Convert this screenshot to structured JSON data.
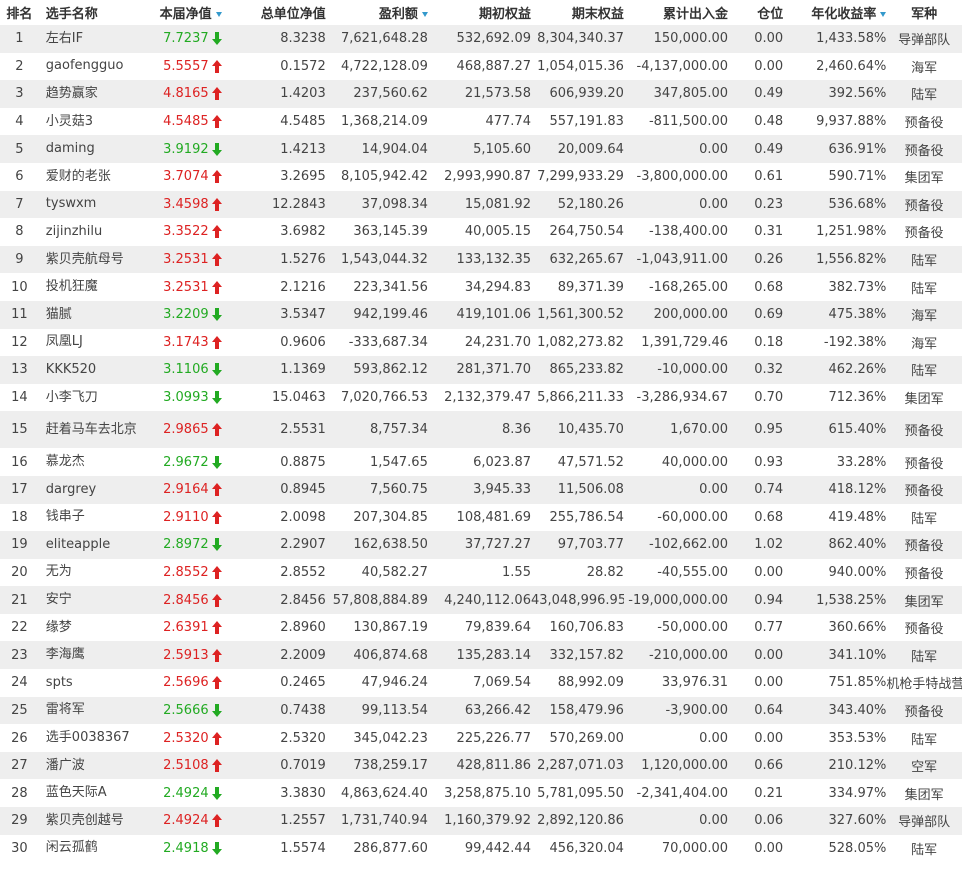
{
  "headers": {
    "rank": "排名",
    "name": "选手名称",
    "nav": "本届净值",
    "total_nav": "总单位净值",
    "profit": "盈利额",
    "initial_equity": "期初权益",
    "final_equity": "期末权益",
    "net_inout": "累计出入金",
    "position": "仓位",
    "annual_return": "年化收益率",
    "army": "军种"
  },
  "sorted_columns": [
    "nav",
    "profit",
    "annual_return"
  ],
  "colors": {
    "up": "#dd2222",
    "down": "#22aa22",
    "sort_icon": "#3399cc",
    "row_even": "#eeeeee"
  },
  "rows": [
    {
      "rank": "1",
      "name": "左右IF",
      "nav": "7.7237",
      "trend": "down",
      "total_nav": "8.3238",
      "profit": "7,621,648.28",
      "initial_equity": "532,692.09",
      "final_equity": "8,304,340.37",
      "net_inout": "150,000.00",
      "position": "0.00",
      "annual_return": "1,433.58%",
      "army": "导弹部队"
    },
    {
      "rank": "2",
      "name": "gaofengguo",
      "nav": "5.5557",
      "trend": "up",
      "total_nav": "0.1572",
      "profit": "4,722,128.09",
      "initial_equity": "468,887.27",
      "final_equity": "1,054,015.36",
      "net_inout": "-4,137,000.00",
      "position": "0.00",
      "annual_return": "2,460.64%",
      "army": "海军"
    },
    {
      "rank": "3",
      "name": "趋势赢家",
      "nav": "4.8165",
      "trend": "up",
      "total_nav": "1.4203",
      "profit": "237,560.62",
      "initial_equity": "21,573.58",
      "final_equity": "606,939.20",
      "net_inout": "347,805.00",
      "position": "0.49",
      "annual_return": "392.56%",
      "army": "陆军"
    },
    {
      "rank": "4",
      "name": "小灵菇3",
      "nav": "4.5485",
      "trend": "up",
      "total_nav": "4.5485",
      "profit": "1,368,214.09",
      "initial_equity": "477.74",
      "final_equity": "557,191.83",
      "net_inout": "-811,500.00",
      "position": "0.48",
      "annual_return": "9,937.88%",
      "army": "预备役"
    },
    {
      "rank": "5",
      "name": "daming",
      "nav": "3.9192",
      "trend": "down",
      "total_nav": "1.4213",
      "profit": "14,904.04",
      "initial_equity": "5,105.60",
      "final_equity": "20,009.64",
      "net_inout": "0.00",
      "position": "0.49",
      "annual_return": "636.91%",
      "army": "预备役"
    },
    {
      "rank": "6",
      "name": "爱财的老张",
      "nav": "3.7074",
      "trend": "up",
      "total_nav": "3.2695",
      "profit": "8,105,942.42",
      "initial_equity": "2,993,990.87",
      "final_equity": "7,299,933.29",
      "net_inout": "-3,800,000.00",
      "position": "0.61",
      "annual_return": "590.71%",
      "army": "集团军"
    },
    {
      "rank": "7",
      "name": "tyswxm",
      "nav": "3.4598",
      "trend": "up",
      "total_nav": "12.2843",
      "profit": "37,098.34",
      "initial_equity": "15,081.92",
      "final_equity": "52,180.26",
      "net_inout": "0.00",
      "position": "0.23",
      "annual_return": "536.68%",
      "army": "预备役"
    },
    {
      "rank": "8",
      "name": "zijinzhilu",
      "nav": "3.3522",
      "trend": "up",
      "total_nav": "3.6982",
      "profit": "363,145.39",
      "initial_equity": "40,005.15",
      "final_equity": "264,750.54",
      "net_inout": "-138,400.00",
      "position": "0.31",
      "annual_return": "1,251.98%",
      "army": "预备役"
    },
    {
      "rank": "9",
      "name": "紫贝壳航母号",
      "nav": "3.2531",
      "trend": "up",
      "total_nav": "1.5276",
      "profit": "1,543,044.32",
      "initial_equity": "133,132.35",
      "final_equity": "632,265.67",
      "net_inout": "-1,043,911.00",
      "position": "0.26",
      "annual_return": "1,556.82%",
      "army": "陆军"
    },
    {
      "rank": "10",
      "name": "投机狂魔",
      "nav": "3.2531",
      "trend": "up",
      "total_nav": "2.1216",
      "profit": "223,341.56",
      "initial_equity": "34,294.83",
      "final_equity": "89,371.39",
      "net_inout": "-168,265.00",
      "position": "0.68",
      "annual_return": "382.73%",
      "army": "陆军"
    },
    {
      "rank": "11",
      "name": "猫腻",
      "nav": "3.2209",
      "trend": "down",
      "total_nav": "3.5347",
      "profit": "942,199.46",
      "initial_equity": "419,101.06",
      "final_equity": "1,561,300.52",
      "net_inout": "200,000.00",
      "position": "0.69",
      "annual_return": "475.38%",
      "army": "海军"
    },
    {
      "rank": "12",
      "name": "凤凰LJ",
      "nav": "3.1743",
      "trend": "up",
      "total_nav": "0.9606",
      "profit": "-333,687.34",
      "initial_equity": "24,231.70",
      "final_equity": "1,082,273.82",
      "net_inout": "1,391,729.46",
      "position": "0.18",
      "annual_return": "-192.38%",
      "army": "海军"
    },
    {
      "rank": "13",
      "name": "KKK520",
      "nav": "3.1106",
      "trend": "down",
      "total_nav": "1.1369",
      "profit": "593,862.12",
      "initial_equity": "281,371.70",
      "final_equity": "865,233.82",
      "net_inout": "-10,000.00",
      "position": "0.32",
      "annual_return": "462.26%",
      "army": "陆军"
    },
    {
      "rank": "14",
      "name": "小李飞刀",
      "nav": "3.0993",
      "trend": "down",
      "total_nav": "15.0463",
      "profit": "7,020,766.53",
      "initial_equity": "2,132,379.47",
      "final_equity": "5,866,211.33",
      "net_inout": "-3,286,934.67",
      "position": "0.70",
      "annual_return": "712.36%",
      "army": "集团军"
    },
    {
      "rank": "15",
      "name": "赶着马车去北京",
      "nav": "2.9865",
      "trend": "up",
      "total_nav": "2.5531",
      "profit": "8,757.34",
      "initial_equity": "8.36",
      "final_equity": "10,435.70",
      "net_inout": "1,670.00",
      "position": "0.95",
      "annual_return": "615.40%",
      "army": "预备役",
      "tall": true
    },
    {
      "rank": "16",
      "name": "慕龙杰",
      "nav": "2.9672",
      "trend": "down",
      "total_nav": "0.8875",
      "profit": "1,547.65",
      "initial_equity": "6,023.87",
      "final_equity": "47,571.52",
      "net_inout": "40,000.00",
      "position": "0.93",
      "annual_return": "33.28%",
      "army": "预备役"
    },
    {
      "rank": "17",
      "name": "dargrey",
      "nav": "2.9164",
      "trend": "up",
      "total_nav": "0.8945",
      "profit": "7,560.75",
      "initial_equity": "3,945.33",
      "final_equity": "11,506.08",
      "net_inout": "0.00",
      "position": "0.74",
      "annual_return": "418.12%",
      "army": "预备役"
    },
    {
      "rank": "18",
      "name": "钱串子",
      "nav": "2.9110",
      "trend": "up",
      "total_nav": "2.0098",
      "profit": "207,304.85",
      "initial_equity": "108,481.69",
      "final_equity": "255,786.54",
      "net_inout": "-60,000.00",
      "position": "0.68",
      "annual_return": "419.48%",
      "army": "陆军"
    },
    {
      "rank": "19",
      "name": "eliteapple",
      "nav": "2.8972",
      "trend": "down",
      "total_nav": "2.2907",
      "profit": "162,638.50",
      "initial_equity": "37,727.27",
      "final_equity": "97,703.77",
      "net_inout": "-102,662.00",
      "position": "1.02",
      "annual_return": "862.40%",
      "army": "预备役"
    },
    {
      "rank": "20",
      "name": "无为",
      "nav": "2.8552",
      "trend": "up",
      "total_nav": "2.8552",
      "profit": "40,582.27",
      "initial_equity": "1.55",
      "final_equity": "28.82",
      "net_inout": "-40,555.00",
      "position": "0.00",
      "annual_return": "940.00%",
      "army": "预备役"
    },
    {
      "rank": "21",
      "name": "安宁",
      "nav": "2.8456",
      "trend": "up",
      "total_nav": "2.8456",
      "profit": "57,808,884.89",
      "initial_equity": "4,240,112.06",
      "final_equity": "43,048,996.95",
      "net_inout": "-19,000,000.00",
      "position": "0.94",
      "annual_return": "1,538.25%",
      "army": "集团军"
    },
    {
      "rank": "22",
      "name": "缘梦",
      "nav": "2.6391",
      "trend": "up",
      "total_nav": "2.8960",
      "profit": "130,867.19",
      "initial_equity": "79,839.64",
      "final_equity": "160,706.83",
      "net_inout": "-50,000.00",
      "position": "0.77",
      "annual_return": "360.66%",
      "army": "预备役"
    },
    {
      "rank": "23",
      "name": "李海鹰",
      "nav": "2.5913",
      "trend": "up",
      "total_nav": "2.2009",
      "profit": "406,874.68",
      "initial_equity": "135,283.14",
      "final_equity": "332,157.82",
      "net_inout": "-210,000.00",
      "position": "0.00",
      "annual_return": "341.10%",
      "army": "陆军"
    },
    {
      "rank": "24",
      "name": "spts",
      "nav": "2.5696",
      "trend": "up",
      "total_nav": "0.2465",
      "profit": "47,946.24",
      "initial_equity": "7,069.54",
      "final_equity": "88,992.09",
      "net_inout": "33,976.31",
      "position": "0.00",
      "annual_return": "751.85%",
      "army": "机枪手特战营"
    },
    {
      "rank": "25",
      "name": "雷将军",
      "nav": "2.5666",
      "trend": "down",
      "total_nav": "0.7438",
      "profit": "99,113.54",
      "initial_equity": "63,266.42",
      "final_equity": "158,479.96",
      "net_inout": "-3,900.00",
      "position": "0.64",
      "annual_return": "343.40%",
      "army": "预备役"
    },
    {
      "rank": "26",
      "name": "选手0038367",
      "nav": "2.5320",
      "trend": "up",
      "total_nav": "2.5320",
      "profit": "345,042.23",
      "initial_equity": "225,226.77",
      "final_equity": "570,269.00",
      "net_inout": "0.00",
      "position": "0.00",
      "annual_return": "353.53%",
      "army": "陆军"
    },
    {
      "rank": "27",
      "name": "潘广波",
      "nav": "2.5108",
      "trend": "up",
      "total_nav": "0.7019",
      "profit": "738,259.17",
      "initial_equity": "428,811.86",
      "final_equity": "2,287,071.03",
      "net_inout": "1,120,000.00",
      "position": "0.66",
      "annual_return": "210.12%",
      "army": "空军"
    },
    {
      "rank": "28",
      "name": "蓝色天际A",
      "nav": "2.4924",
      "trend": "down",
      "total_nav": "3.3830",
      "profit": "4,863,624.40",
      "initial_equity": "3,258,875.10",
      "final_equity": "5,781,095.50",
      "net_inout": "-2,341,404.00",
      "position": "0.21",
      "annual_return": "334.97%",
      "army": "集团军"
    },
    {
      "rank": "29",
      "name": "紫贝壳创越号",
      "nav": "2.4924",
      "trend": "up",
      "total_nav": "1.2557",
      "profit": "1,731,740.94",
      "initial_equity": "1,160,379.92",
      "final_equity": "2,892,120.86",
      "net_inout": "0.00",
      "position": "0.06",
      "annual_return": "327.60%",
      "army": "导弹部队"
    },
    {
      "rank": "30",
      "name": "闲云孤鹤",
      "nav": "2.4918",
      "trend": "down",
      "total_nav": "1.5574",
      "profit": "286,877.60",
      "initial_equity": "99,442.44",
      "final_equity": "456,320.04",
      "net_inout": "70,000.00",
      "position": "0.00",
      "annual_return": "528.05%",
      "army": "陆军"
    }
  ]
}
